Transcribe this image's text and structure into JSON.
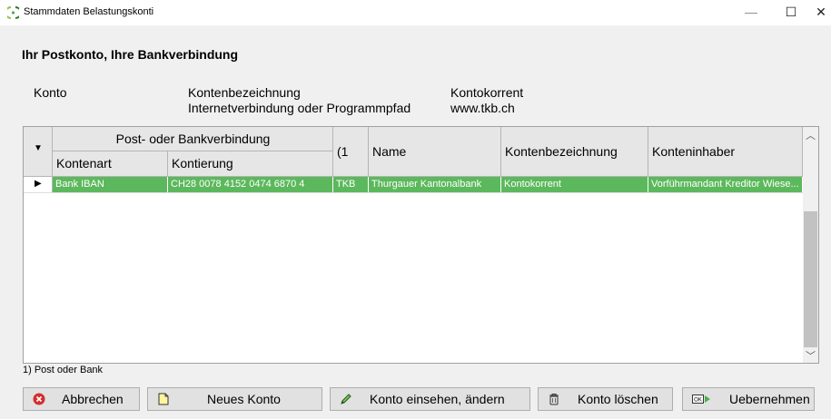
{
  "window": {
    "title": "Stammdaten Belastungskonti"
  },
  "heading": "Ihr Postkonto, Ihre Bankverbindung",
  "info": {
    "col1_label": "Konto",
    "col2_line1": "Kontenbezeichnung",
    "col2_line2": "Internetverbindung oder Programmpfad",
    "col3_line1": "Kontokorrent",
    "col3_line2": "www.tkb.ch"
  },
  "grid": {
    "group_header": "Post- oder Bankverbindung",
    "headers": {
      "kontenart": "Kontenart",
      "kontierung": "Kontierung",
      "type": "(1",
      "name": "Name",
      "kontenbezeichnung": "Kontenbezeichnung",
      "konteninhaber": "Konteninhaber"
    },
    "rows": [
      {
        "kontenart": "Bank IBAN",
        "kontierung": "CH28 0078 4152 0474 6870 4",
        "type": "TKB",
        "name": "Thurgauer Kantonalbank",
        "kontenbezeichnung": "Kontokorrent",
        "konteninhaber": "Vorführmandant Kreditor Wiese..."
      }
    ],
    "selected_row_color": "#5cb85c"
  },
  "footnote": "1) Post oder Bank",
  "buttons": {
    "cancel": "Abbrechen",
    "new_account": "Neues Konto",
    "edit": "Konto einsehen, ändern",
    "delete": "Konto löschen",
    "accept": "Uebernehmen"
  },
  "icons": {
    "cancel": "cancel-icon",
    "new_account": "document-icon",
    "edit": "pencil-icon",
    "delete": "trash-icon",
    "accept": "ok-arrow-icon"
  }
}
